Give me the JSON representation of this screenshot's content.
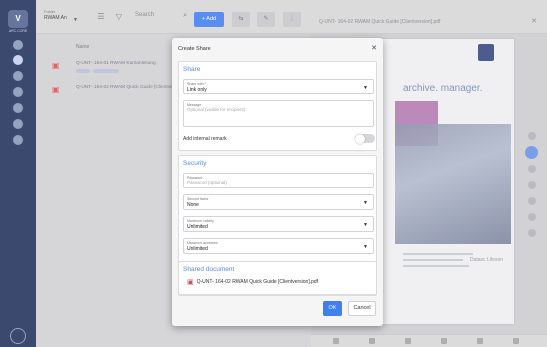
{
  "rail": {
    "logo_text": "V",
    "logo_caption": "ARC.CORE"
  },
  "toolbar": {
    "filter_label": "Folder",
    "filter_value": "RWAM An",
    "search_placeholder": "Search",
    "add_label": "+ Add"
  },
  "list": {
    "column_name": "Name",
    "rows": [
      {
        "name": "Q-UNT- 164-01 RWAM Kurzanleitung"
      },
      {
        "name": "Q-UNT- 164-02 RWAM Quick Guide [Clientversion]"
      }
    ]
  },
  "viewer": {
    "title": "Q-UNT- 164-02 RWAM Quick Guide [Clientversion].pdf",
    "headline": "archive. manager.",
    "signature": "Datasc Lifeson"
  },
  "dialog": {
    "title": "Create Share",
    "share_section": "Share",
    "share_with_label": "Share with *",
    "share_with_value": "Link only",
    "message_label": "Message",
    "message_placeholder": "Optional (visible for recipient)",
    "remark_label": "Add internal remark",
    "remark_enabled": false,
    "security_section": "Security",
    "password_label": "Password",
    "password_placeholder": "Password (optional)",
    "second_factor_label": "Second factor",
    "second_factor_value": "None",
    "validity_label": "Maximum validity",
    "validity_value": "Unlimited",
    "accesses_label": "Maximum accesses",
    "accesses_value": "Unlimited",
    "shared_doc_section": "Shared document",
    "shared_doc_name": "Q-UNT- 164-02 RWAM Quick Guide [Clientversion].pdf",
    "ok_label": "OK",
    "cancel_label": "Cancel"
  },
  "colors": {
    "accent": "#3f7ff0",
    "rail": "#2b3a63",
    "section_title": "#5a8ddc",
    "pdf": "#d84d51"
  }
}
